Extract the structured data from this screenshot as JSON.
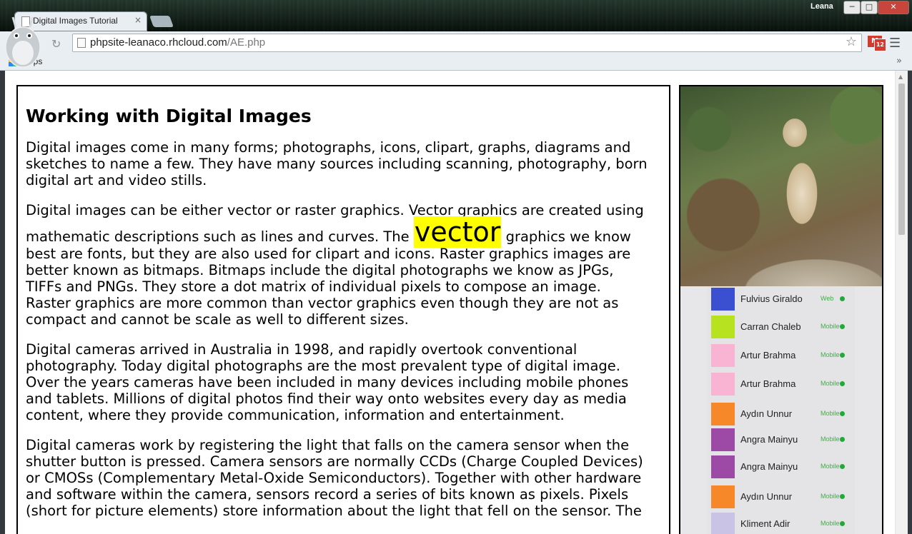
{
  "browser": {
    "tab_title": "Digital Images Tutorial",
    "tab_close": "×",
    "user_name": "Leana",
    "url_host": "phpsite-leanaco.rhcloud.com",
    "url_path": "/AE.php",
    "gmail_badge": "12",
    "bookmarks_apps": "Apps",
    "bookmarks_more": "»",
    "window_buttons": {
      "minimize": "─",
      "maximize": "□",
      "close": "✕"
    }
  },
  "article": {
    "title": "Working with Digital Images",
    "p1": "Digital images come in many forms; photographs, icons, clipart, graphs, diagrams and sketches to name a few. They have many sources including scanning, photography, born digital art and video stills.",
    "p2_before": "Digital images can be either vector or raster graphics. Vector graphics are created using mathematic descriptions such as lines and curves. The ",
    "p2_highlight": "vector",
    "p2_after": " graphics we know best are fonts, but they are also used for clipart and icons. Raster graphics images are better known as bitmaps. Bitmaps include the digital photographs we know as JPGs, TIFFs and PNGs. They store a dot matrix of individual pixels to compose an image. Raster graphics are more common than vector graphics even though they are not as compact and cannot be scale as well to different sizes.",
    "p3": "Digital cameras arrived in Australia in 1998, and rapidly overtook conventional photography. Today digital photographs are the most prevalent type of digital image. Over the years cameras have been included in many devices including mobile phones and tablets. Millions of digital photos find their way onto websites every day as media content, where they provide communication, information and entertainment.",
    "p4": "Digital cameras work by registering the light that falls on the camera sensor when the shutter button is pressed. Camera sensors are normally CCDs (Charge Coupled Devices) or CMOSs (Complementary Metal-Oxide Semiconductors). Together with other hardware and software within the camera, sensors record a series of bits known as pixels. Pixels (short for picture elements) store information about the light that fell on the sensor. The"
  },
  "sidebar": {
    "users": [
      {
        "name": "Fulvius Giraldo",
        "status": "Web",
        "color": "#3b4fd1"
      },
      {
        "name": "Carran Chaleb",
        "status": "Mobile",
        "color": "#b7e21f"
      },
      {
        "name": "Artur Brahma",
        "status": "Mobile",
        "color": "#f8b4d2"
      },
      {
        "name": "Artur Brahma",
        "status": "Mobile",
        "color": "#f8b4d2"
      },
      {
        "name": "Aydın Unnur",
        "status": "Mobile",
        "color": "#f6882a"
      },
      {
        "name": "Angra Mainyu",
        "status": "Mobile",
        "color": "#9c4aa6"
      },
      {
        "name": "Angra Mainyu",
        "status": "Mobile",
        "color": "#9c4aa6"
      },
      {
        "name": "Aydın Unnur",
        "status": "Mobile",
        "color": "#f6882a"
      },
      {
        "name": "Kliment Adir",
        "status": "Mobile",
        "color": "#c9c3e6"
      }
    ]
  }
}
